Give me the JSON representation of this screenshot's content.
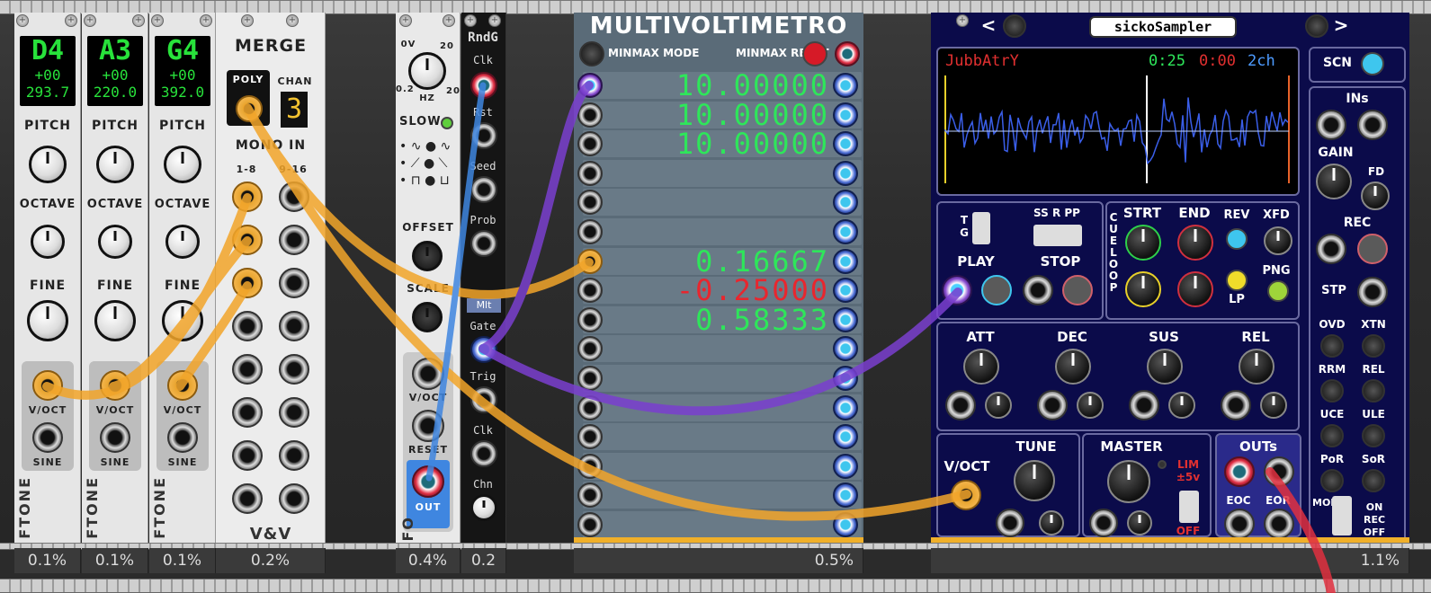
{
  "tuners": [
    {
      "note": "D4",
      "cents": "+00",
      "freq": "293.7"
    },
    {
      "note": "A3",
      "cents": "+00",
      "freq": "220.0"
    },
    {
      "note": "G4",
      "cents": "+00",
      "freq": "392.0"
    }
  ],
  "tuner_labels": {
    "pitch": "PITCH",
    "octave": "OCTAVE",
    "fine": "FINE",
    "voct": "V/OCT",
    "sine": "SINE",
    "brand": "FTONE"
  },
  "merge": {
    "title": "MERGE",
    "poly": "POLY",
    "chan": "CHAN",
    "channels": "3",
    "mono_in": "MONO IN",
    "range1": "1-8",
    "range2": "9-16",
    "brand": "V&V"
  },
  "lfo": {
    "range_low": "0.2",
    "range_0": "0V",
    "range_20": "20",
    "range_200": "200",
    "hz": "HZ",
    "slow": "SLOW",
    "offset": "OFFSET",
    "scale": "SCALE",
    "voct": "V/OCT",
    "reset": "RESET",
    "out": "OUT",
    "brand": "FO"
  },
  "rndg": {
    "title": "RndG",
    "clk": "Clk",
    "rst": "Rst",
    "seed": "Seed",
    "prob": "Prob",
    "mode": "Mlt",
    "gate": "Gate",
    "trig": "Trig",
    "clk2": "Clk",
    "chn": "Chn"
  },
  "multivolt": {
    "title": "MULTIVOLTIMETRO",
    "minmax_mode": "MINMAX MODE",
    "minmax_reset": "MINMAX RESET",
    "rows": [
      {
        "value": "10.00000",
        "color": "#2ee65a"
      },
      {
        "value": "10.00000",
        "color": "#2ee65a"
      },
      {
        "value": "10.00000",
        "color": "#2ee65a"
      },
      {
        "value": "",
        "color": "#2ee65a"
      },
      {
        "value": "",
        "color": "#2ee65a"
      },
      {
        "value": "",
        "color": "#2ee65a"
      },
      {
        "value": "0.16667",
        "color": "#2ee65a"
      },
      {
        "value": "-0.25000",
        "color": "#e8262e"
      },
      {
        "value": "0.58333",
        "color": "#2ee65a"
      },
      {
        "value": "",
        "color": "#2ee65a"
      },
      {
        "value": "",
        "color": "#2ee65a"
      },
      {
        "value": "",
        "color": "#2ee65a"
      },
      {
        "value": "",
        "color": "#2ee65a"
      },
      {
        "value": "",
        "color": "#2ee65a"
      },
      {
        "value": "",
        "color": "#2ee65a"
      },
      {
        "value": "",
        "color": "#2ee65a"
      }
    ]
  },
  "sampler": {
    "title": "sickoSampler",
    "file": "JubbAtrY",
    "time1": "0:25",
    "time2": "0:00",
    "channels": "2ch",
    "scn": "SCN",
    "ins": "INs",
    "gain": "GAIN",
    "fd": "FD",
    "rec": "REC",
    "stp": "STP",
    "ovd": "OVD",
    "xtn": "XTN",
    "rrm": "RRM",
    "rel2": "REL",
    "uce": "UCE",
    "ule": "ULE",
    "por": "PoR",
    "sor": "SoR",
    "mon": "MON",
    "on": "ON",
    "recopt": "REC",
    "off": "OFF",
    "tg": "T G",
    "ssrpp": "SS R PP",
    "play": "PLAY",
    "stop": "STOP",
    "strt": "STRT",
    "end": "END",
    "rev": "REV",
    "xfd": "XFD",
    "cue_loop": "CUE LOOP",
    "lp": "LP",
    "png": "PNG",
    "att": "ATT",
    "dec": "DEC",
    "sus": "SUS",
    "rel": "REL",
    "voct": "V/OCT",
    "tune": "TUNE",
    "master": "MASTER",
    "lim": "LIM ±5v",
    "lim_off": "OFF",
    "outs": "OUTs",
    "eoc": "EOC",
    "eor": "EOR",
    "prev": "<",
    "next": ">"
  },
  "cpu": [
    "0.1%",
    "0.1%",
    "0.1%",
    "0.2%",
    "0.4%",
    "0.2",
    "0.5%",
    "1.1%"
  ],
  "colors": {
    "cable_orange": "#f2a52a",
    "cable_purple": "#7a3fcf",
    "cable_blue": "#3f86e0",
    "cable_red": "#e0303f",
    "display_green": "#28e23b"
  }
}
